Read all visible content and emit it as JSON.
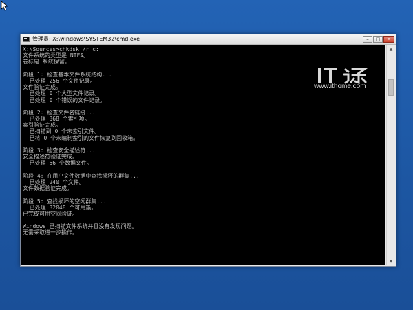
{
  "window": {
    "title": "管理员: X:\\windows\\SYSTEM32\\cmd.exe",
    "minimize_label": "–",
    "maximize_label": "□",
    "close_label": "✕"
  },
  "console": {
    "lines": [
      "X:\\Sources>chkdsk /r c:",
      "文件系统的类型是 NTFS。",
      "卷标是 系统保留。",
      "",
      "阶段 1: 检查基本文件系统结构...",
      "  已处理 256 个文件记录。",
      "文件验证完成。",
      "  已处理 0 个大型文件记录。",
      "  已处理 0 个错误的文件记录。",
      "",
      "阶段 2: 检查文件名链接...",
      "  已处理 368 个索引项。",
      "索引验证完成。",
      "  已扫描到 0 个未索引文件。",
      "  已将 0 个未编制索引的文件恢复到回收箱。",
      "",
      "阶段 3: 检查安全描述符...",
      "安全描述符验证完成。",
      "  已处理 56 个数据文件。",
      "",
      "阶段 4: 在用户文件数据中查找损坏的群集...",
      "  已处理 240 个文件。",
      "文件数据验证完成。",
      "",
      "阶段 5: 查找损坏的空闲群集...",
      "  已处理 32048 个可用簇。",
      "已完成可用空间验证。",
      "",
      "Windows 已扫描文件系统并且没有发现问题。",
      "无需采取进一步操作。"
    ]
  },
  "scrollbar": {
    "up_arrow": "▲",
    "down_arrow": "▼"
  },
  "watermark": {
    "url": "www.ithome.com"
  },
  "colors": {
    "desktop": "#1f5aa6",
    "console_bg": "#000000",
    "console_text": "#c0c0c0"
  }
}
